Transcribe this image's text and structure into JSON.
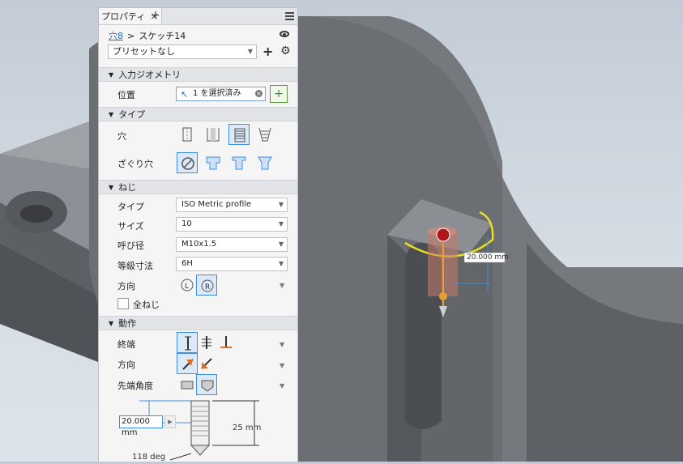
{
  "panel": {
    "tab_label": "プロパティ",
    "tab_close": "×",
    "tab_add": "+",
    "breadcrumb": {
      "parent": "穴8",
      "separator": ">",
      "current": "スケッチ14"
    },
    "preset": {
      "value": "プリセットなし",
      "add": "+",
      "gear": "⚙"
    }
  },
  "input_geometry": {
    "header": "入力ジオメトリ",
    "position_label": "位置",
    "selection_text": "1 を選択済み"
  },
  "type": {
    "header": "タイプ",
    "hole_label": "穴",
    "counterbore_label": "ざぐり穴"
  },
  "thread": {
    "header": "ねじ",
    "type_label": "タイプ",
    "type_value": "ISO Metric profile",
    "size_label": "サイズ",
    "size_value": "10",
    "designation_label": "呼び径",
    "designation_value": "M10x1.5",
    "class_label": "等級寸法",
    "class_value": "6H",
    "direction_label": "方向",
    "full_thread_label": "全ねじ"
  },
  "behavior": {
    "header": "動作",
    "termination_label": "終端",
    "direction_label": "方向",
    "drill_point_label": "先端角度",
    "depth_value": "20.000 mm",
    "thread_depth": "25 mm",
    "angle": "118 deg"
  },
  "viewport": {
    "dimension_label": "20.000 mm",
    "colors": {
      "model": "#6e7176",
      "highlight": "#e8e020",
      "accent": "#3d8ee0",
      "hole": "#c97a6a"
    }
  }
}
